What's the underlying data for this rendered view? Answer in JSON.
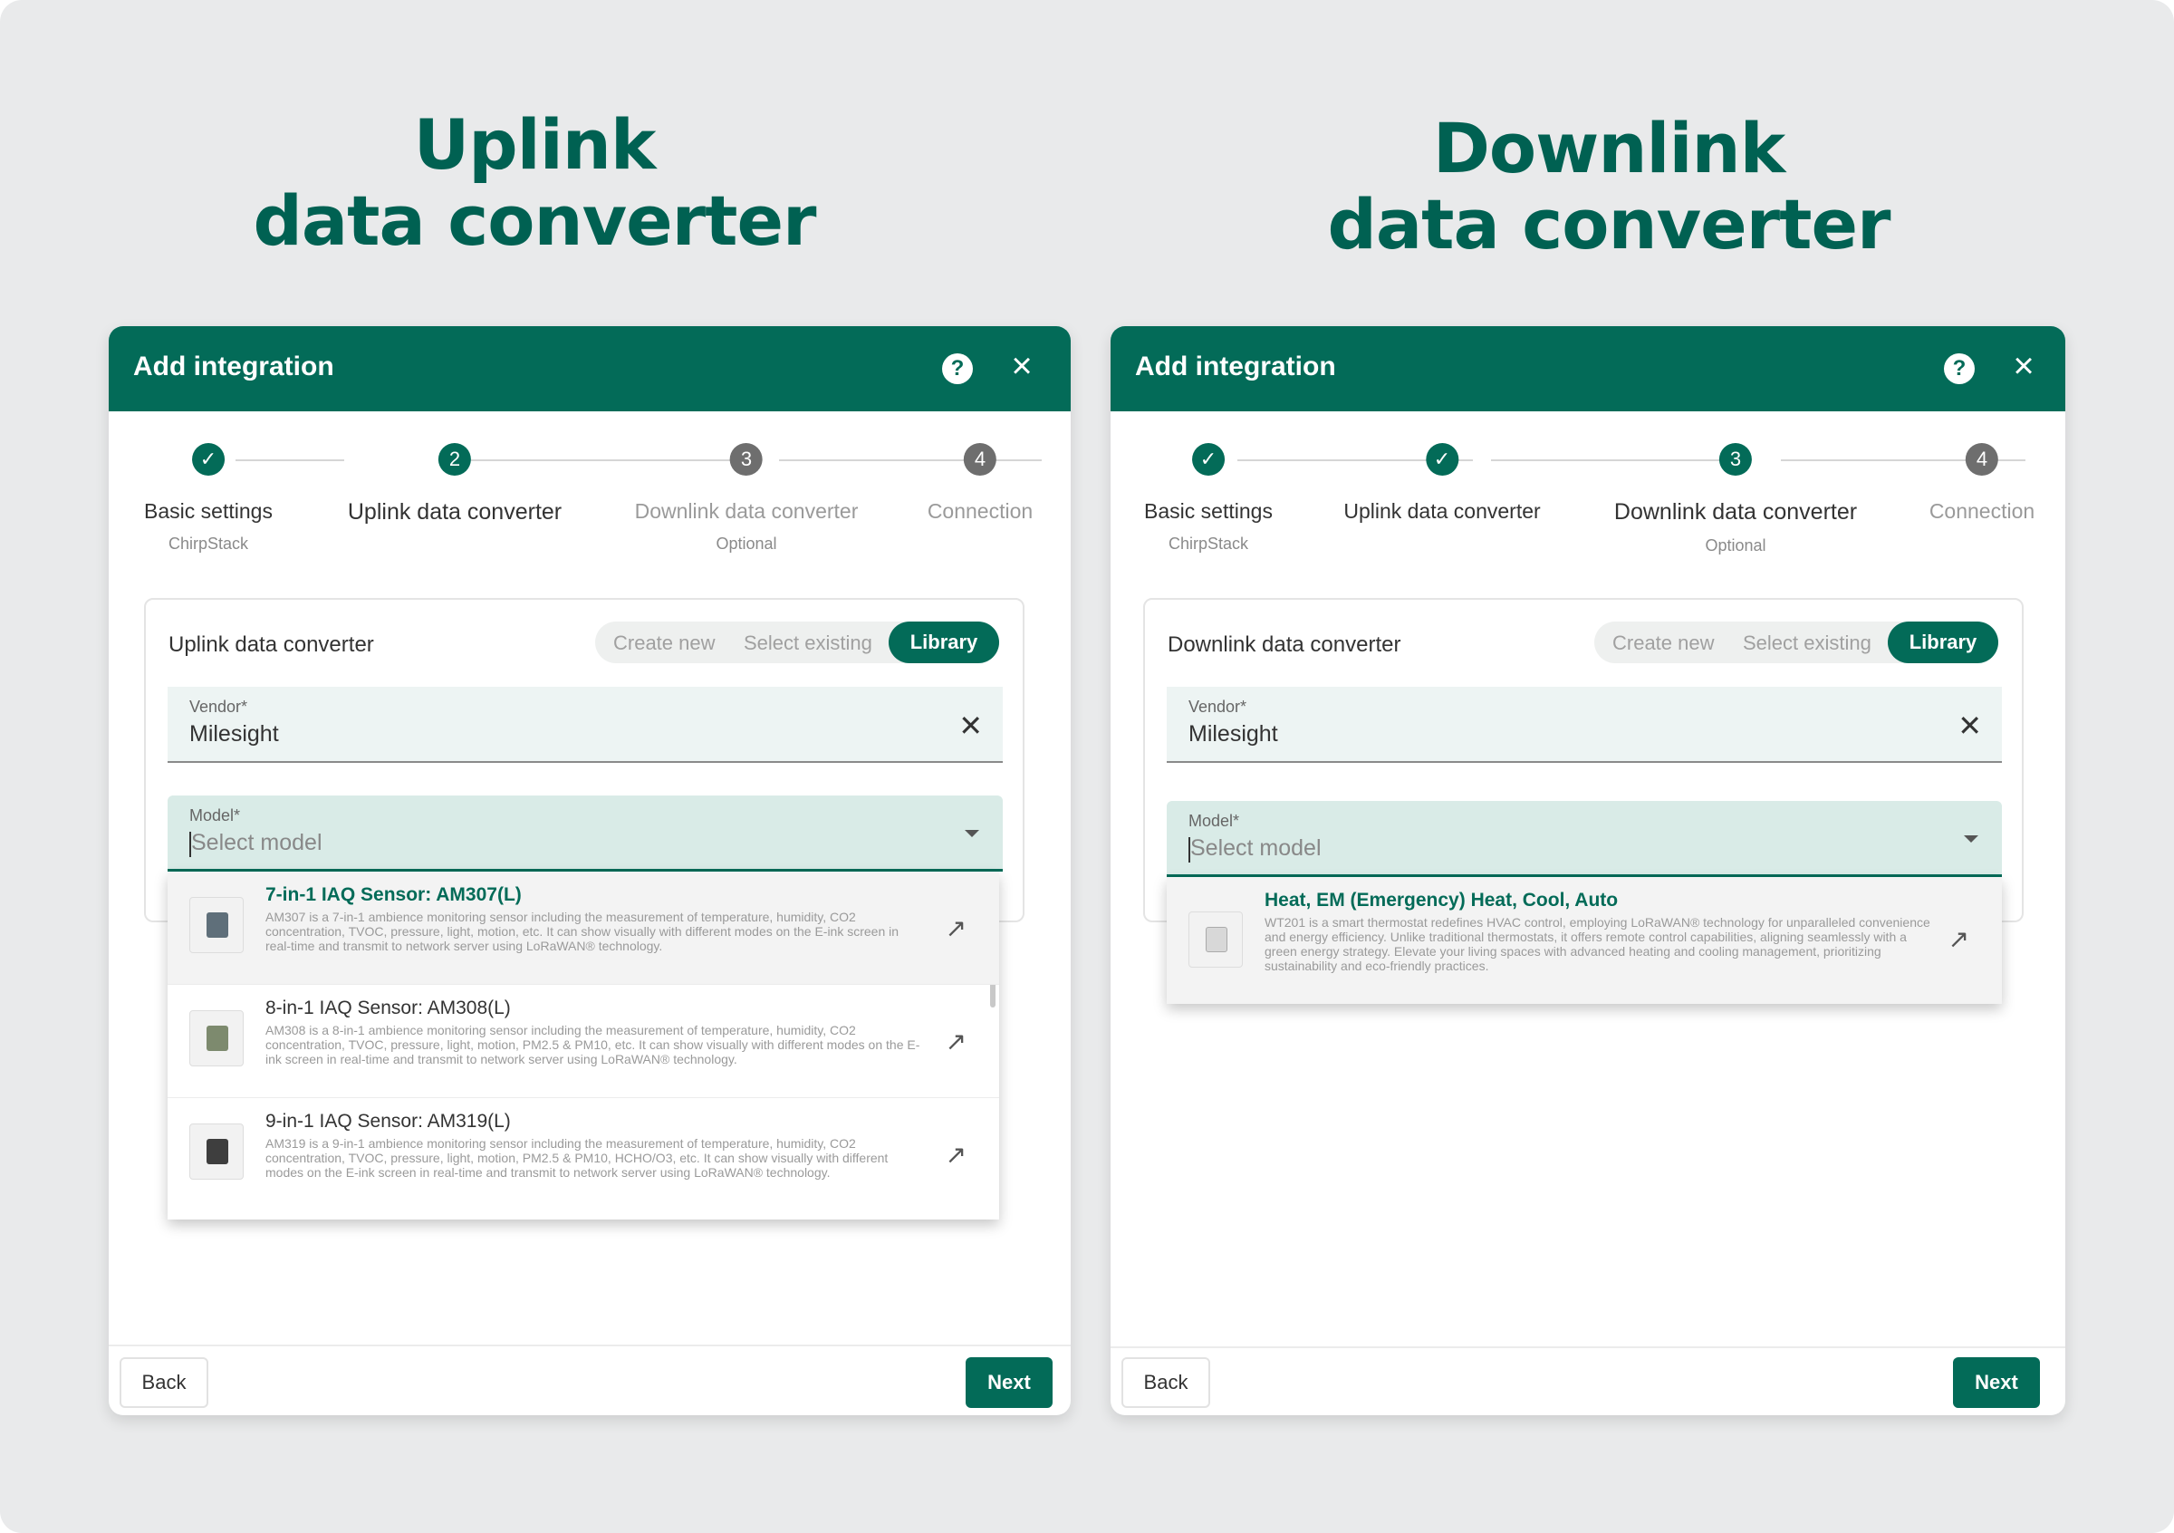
{
  "left": {
    "heading": [
      "Uplink",
      "data converter"
    ],
    "dialog_title": "Add integration",
    "steps": [
      {
        "num": "✓",
        "label": "Basic settings",
        "sub": "ChirpStack",
        "state": "done"
      },
      {
        "num": "2",
        "label": "Uplink data converter",
        "sub": "",
        "state": "active"
      },
      {
        "num": "3",
        "label": "Downlink data converter",
        "sub": "Optional",
        "state": "todo"
      },
      {
        "num": "4",
        "label": "Connection",
        "sub": "",
        "state": "todo"
      }
    ],
    "card_title": "Uplink data converter",
    "toggle": {
      "create": "Create new",
      "select": "Select existing",
      "library": "Library"
    },
    "vendor": {
      "label": "Vendor*",
      "value": "Milesight"
    },
    "model": {
      "label": "Model*",
      "placeholder": "Select model"
    },
    "options": [
      {
        "title": "7-in-1 IAQ Sensor: AM307(L)",
        "desc": "AM307 is a 7-in-1 ambience monitoring sensor including the measurement of temperature, humidity, CO2 concentration, TVOC, pressure, light, motion, etc. It can show visually with different modes on the E-ink screen in real-time and transmit to network server using LoRaWAN® technology."
      },
      {
        "title": "8-in-1 IAQ Sensor: AM308(L)",
        "desc": "AM308 is a 8-in-1 ambience monitoring sensor including the measurement of temperature, humidity, CO2 concentration, TVOC, pressure, light, motion, PM2.5 & PM10, etc. It can show visually with different modes on the E-ink screen in real-time and transmit to network server using LoRaWAN® technology."
      },
      {
        "title": "9-in-1 IAQ Sensor: AM319(L)",
        "desc": "AM319 is a 9-in-1 ambience monitoring sensor including the measurement of temperature, humidity, CO2 concentration, TVOC, pressure, light, motion, PM2.5 & PM10, HCHO/O3, etc. It can show visually with different modes on the E-ink screen in real-time and transmit to network server using LoRaWAN® technology."
      }
    ],
    "back": "Back",
    "next": "Next"
  },
  "right": {
    "heading": [
      "Downlink",
      "data converter"
    ],
    "dialog_title": "Add integration",
    "steps": [
      {
        "num": "✓",
        "label": "Basic settings",
        "sub": "ChirpStack",
        "state": "done"
      },
      {
        "num": "✓",
        "label": "Uplink data converter",
        "sub": "",
        "state": "done"
      },
      {
        "num": "3",
        "label": "Downlink data converter",
        "sub": "Optional",
        "state": "active"
      },
      {
        "num": "4",
        "label": "Connection",
        "sub": "",
        "state": "todo"
      }
    ],
    "card_title": "Downlink data converter",
    "toggle": {
      "create": "Create new",
      "select": "Select existing",
      "library": "Library"
    },
    "vendor": {
      "label": "Vendor*",
      "value": "Milesight"
    },
    "model": {
      "label": "Model*",
      "placeholder": "Select model"
    },
    "options": [
      {
        "title": "Heat, EM (Emergency) Heat, Cool, Auto",
        "desc": "WT201 is a smart thermostat redefines HVAC control, employing LoRaWAN® technology for unparalleled convenience and energy efficiency. Unlike traditional thermostats, it offers remote control capabilities, aligning seamlessly with a green energy strategy. Elevate your living spaces with advanced heating and cooling management, prioritizing sustainability and eco-friendly practices."
      }
    ],
    "back": "Back",
    "next": "Next"
  }
}
